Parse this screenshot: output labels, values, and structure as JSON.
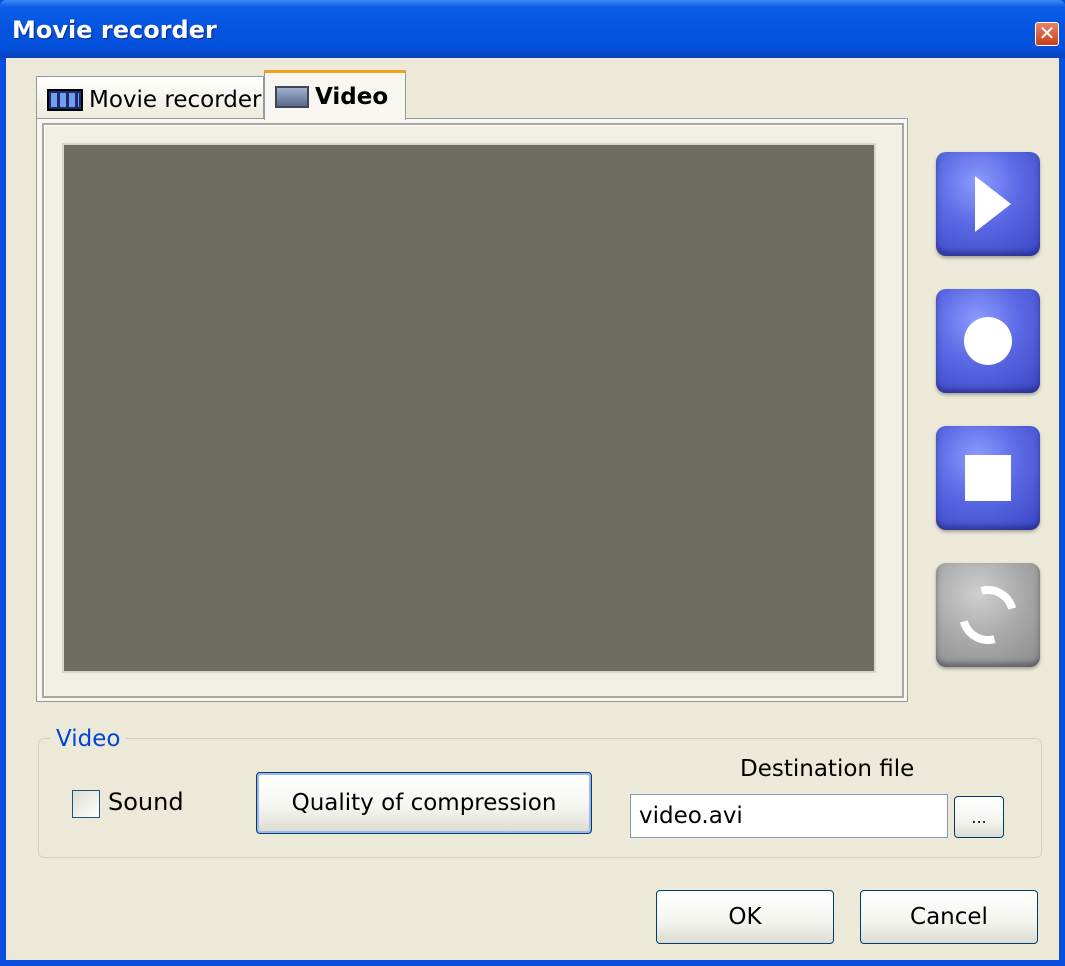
{
  "window": {
    "title": "Movie recorder",
    "close_glyph": "✕"
  },
  "tabs": [
    {
      "label": "Movie recorder",
      "icon": "film-icon",
      "selected": false
    },
    {
      "label": "Video",
      "icon": "monitor-icon",
      "selected": true
    }
  ],
  "controls": {
    "play_icon": "play-icon",
    "record_icon": "record-icon",
    "stop_icon": "stop-icon",
    "refresh_icon": "refresh-icon"
  },
  "video_group": {
    "label": "Video",
    "sound_label": "Sound",
    "sound_checked": false,
    "quality_button": "Quality of compression",
    "destination_label": "Destination file",
    "destination_value": "video.avi",
    "browse_label": "..."
  },
  "footer": {
    "ok_label": "OK",
    "cancel_label": "Cancel"
  }
}
